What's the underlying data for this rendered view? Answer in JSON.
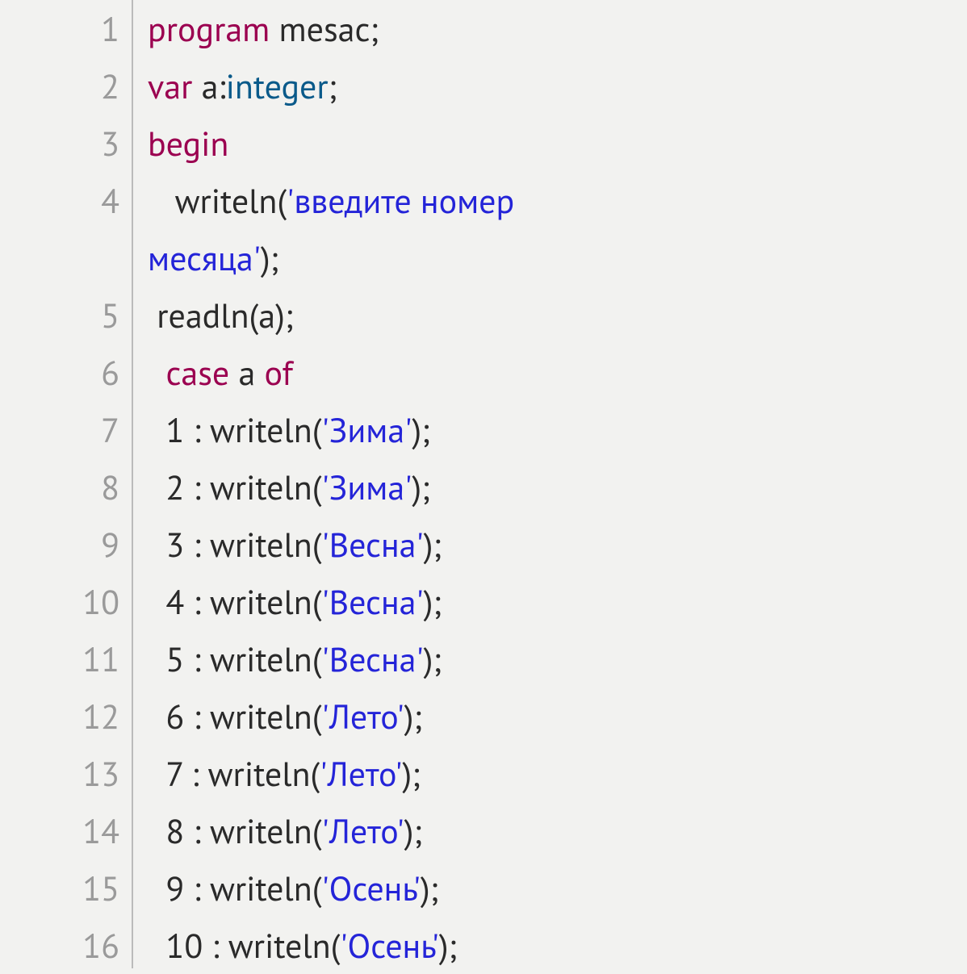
{
  "colors": {
    "keyword": "#9b0050",
    "type": "#0a5a8a",
    "string": "#2424d8",
    "text": "#2a2a2a",
    "gutter": "#9a9a9a",
    "background": "#f2f2f0"
  },
  "lines": [
    {
      "num": "1",
      "tokens": [
        {
          "t": "kw",
          "v": "program"
        },
        {
          "t": "ident",
          "v": " mesac"
        },
        {
          "t": "punct",
          "v": ";"
        }
      ]
    },
    {
      "num": "2",
      "tokens": [
        {
          "t": "kw",
          "v": "var"
        },
        {
          "t": "ident",
          "v": " a:"
        },
        {
          "t": "type",
          "v": "integer"
        },
        {
          "t": "punct",
          "v": ";"
        }
      ]
    },
    {
      "num": "3",
      "tokens": [
        {
          "t": "kw",
          "v": "begin"
        }
      ]
    },
    {
      "num": "4",
      "tokens": [
        {
          "t": "ident",
          "v": "   writeln("
        },
        {
          "t": "str",
          "v": "'введите номер "
        }
      ]
    },
    {
      "num": "",
      "tokens": [
        {
          "t": "str",
          "v": "месяца'"
        },
        {
          "t": "punct",
          "v": ");"
        }
      ],
      "wrap": true
    },
    {
      "num": "5",
      "tokens": [
        {
          "t": "ident",
          "v": " readln(a);"
        }
      ]
    },
    {
      "num": "6",
      "tokens": [
        {
          "t": "ident",
          "v": "  "
        },
        {
          "t": "kw",
          "v": "case"
        },
        {
          "t": "ident",
          "v": " a "
        },
        {
          "t": "kw",
          "v": "of"
        }
      ]
    },
    {
      "num": "7",
      "tokens": [
        {
          "t": "ident",
          "v": "  1 : writeln("
        },
        {
          "t": "str",
          "v": "'Зима'"
        },
        {
          "t": "punct",
          "v": ");"
        }
      ]
    },
    {
      "num": "8",
      "tokens": [
        {
          "t": "ident",
          "v": "  2 : writeln("
        },
        {
          "t": "str",
          "v": "'Зима'"
        },
        {
          "t": "punct",
          "v": ");"
        }
      ]
    },
    {
      "num": "9",
      "tokens": [
        {
          "t": "ident",
          "v": "  3 : writeln("
        },
        {
          "t": "str",
          "v": "'Весна'"
        },
        {
          "t": "punct",
          "v": ");"
        }
      ]
    },
    {
      "num": "10",
      "tokens": [
        {
          "t": "ident",
          "v": "  4 : writeln("
        },
        {
          "t": "str",
          "v": "'Весна'"
        },
        {
          "t": "punct",
          "v": ");"
        }
      ]
    },
    {
      "num": "11",
      "tokens": [
        {
          "t": "ident",
          "v": "  5 : writeln("
        },
        {
          "t": "str",
          "v": "'Весна'"
        },
        {
          "t": "punct",
          "v": ");"
        }
      ]
    },
    {
      "num": "12",
      "tokens": [
        {
          "t": "ident",
          "v": "  6 : writeln("
        },
        {
          "t": "str",
          "v": "'Лето'"
        },
        {
          "t": "punct",
          "v": ");"
        }
      ]
    },
    {
      "num": "13",
      "tokens": [
        {
          "t": "ident",
          "v": "  7 : writeln("
        },
        {
          "t": "str",
          "v": "'Лето'"
        },
        {
          "t": "punct",
          "v": ");"
        }
      ]
    },
    {
      "num": "14",
      "tokens": [
        {
          "t": "ident",
          "v": "  8 : writeln("
        },
        {
          "t": "str",
          "v": "'Лето'"
        },
        {
          "t": "punct",
          "v": ");"
        }
      ]
    },
    {
      "num": "15",
      "tokens": [
        {
          "t": "ident",
          "v": "  9 : writeln("
        },
        {
          "t": "str",
          "v": "'Осень'"
        },
        {
          "t": "punct",
          "v": ");"
        }
      ]
    },
    {
      "num": "16",
      "tokens": [
        {
          "t": "ident",
          "v": "  10 : writeln("
        },
        {
          "t": "str",
          "v": "'Осень'"
        },
        {
          "t": "punct",
          "v": ");"
        }
      ]
    }
  ]
}
